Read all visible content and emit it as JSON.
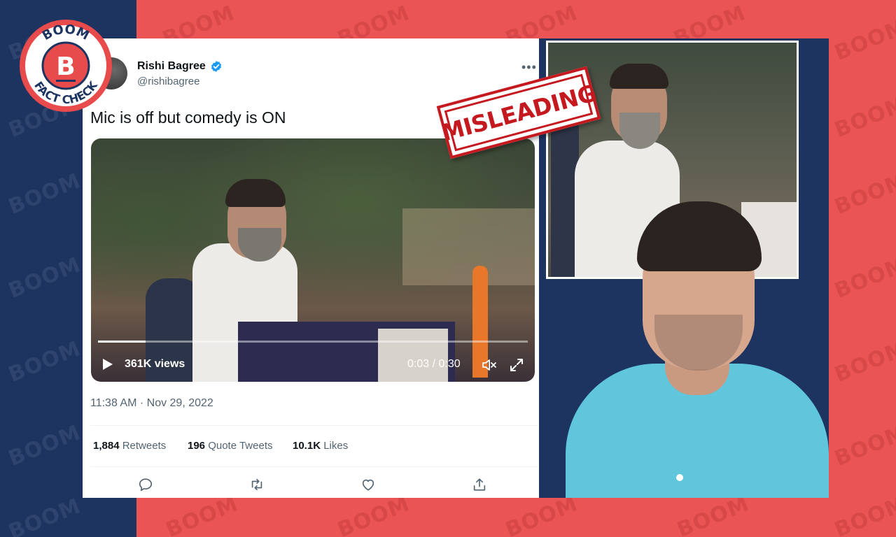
{
  "badge": {
    "top_text": "BOOM",
    "letter": "B",
    "bottom_text": "FACT CHECK"
  },
  "watermark_text": "BOOM",
  "stamp": {
    "label": "MISLEADING"
  },
  "tweet": {
    "author_name": "Rishi Bagree",
    "author_handle": "@rishibagree",
    "more_label": "•••",
    "text": "Mic is off but comedy is ON",
    "video": {
      "views": "361K views",
      "time": "0:03 / 0:30",
      "progress": 0.11
    },
    "timestamp": "11:38 AM · Nov 29, 2022",
    "stats": {
      "retweets_count": "1,884",
      "retweets_label": "Retweets",
      "quotes_count": "196",
      "quotes_label": "Quote Tweets",
      "likes_count": "10.1K",
      "likes_label": "Likes"
    },
    "actions": [
      "reply-icon",
      "retweet-icon",
      "like-icon",
      "share-icon"
    ]
  },
  "colors": {
    "background_red": "#ea5454",
    "background_navy": "#1d3461",
    "stamp_red": "#c4191f",
    "verified_blue": "#1d9bf0",
    "shirt_blue": "#5fc6dc"
  }
}
